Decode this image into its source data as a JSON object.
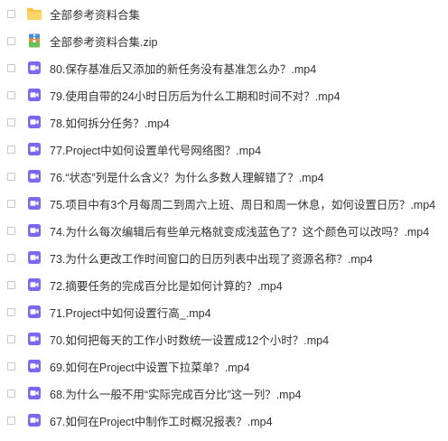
{
  "colors": {
    "folder": "#F7C343",
    "video": "#7C67F2",
    "text": "#333333",
    "checkbox_border": "#C4C8CE"
  },
  "files": [
    {
      "name": "全部参考资料合集",
      "icon": "folder-icon"
    },
    {
      "name": "全部参考资料合集.zip",
      "icon": "zip-icon"
    },
    {
      "name": "80.保存基准后又添加的新任务没有基准怎么办？.mp4",
      "icon": "video-icon"
    },
    {
      "name": "79.使用自带的24小时日历后为什么工期和时间不对？.mp4",
      "icon": "video-icon"
    },
    {
      "name": "78.如何拆分任务？.mp4",
      "icon": "video-icon"
    },
    {
      "name": "77.Project中如何设置单代号网络图？.mp4",
      "icon": "video-icon"
    },
    {
      "name": "76.“状态”列是什么含义？为什么多数人理解错了？.mp4",
      "icon": "video-icon"
    },
    {
      "name": "75.项目中有3个月每周二到周六上班、周日和周一休息，如何设置日历？.mp4",
      "icon": "video-icon"
    },
    {
      "name": "74.为什么每次编辑后有些单元格就变成浅蓝色了？这个颜色可以改吗？.mp4",
      "icon": "video-icon"
    },
    {
      "name": "73.为什么更改工作时间窗口的日历列表中出现了资源名称？.mp4",
      "icon": "video-icon"
    },
    {
      "name": "72.摘要任务的完成百分比是如何计算的？.mp4",
      "icon": "video-icon"
    },
    {
      "name": "71.Project中如何设置行高_.mp4",
      "icon": "video-icon"
    },
    {
      "name": "70.如何把每天的工作小时数统一设置成12个小时？.mp4",
      "icon": "video-icon"
    },
    {
      "name": "69.如何在Project中设置下拉菜单？.mp4",
      "icon": "video-icon"
    },
    {
      "name": "68.为什么一般不用“实际完成百分比”这一列？.mp4",
      "icon": "video-icon"
    },
    {
      "name": "67.如何在Project中制作工时概况报表？.mp4",
      "icon": "video-icon"
    }
  ]
}
